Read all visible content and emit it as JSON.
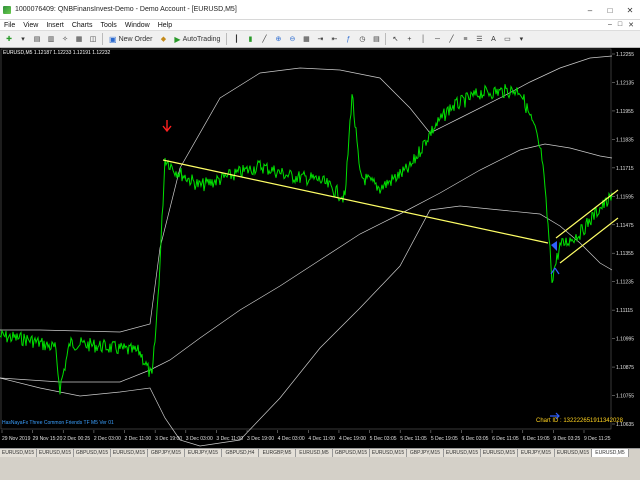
{
  "window": {
    "title": "1000076409: QNBFinansInvest-Demo - Demo Account - [EURUSD,M5]",
    "controls": [
      "–",
      "□",
      "✕"
    ]
  },
  "menu": {
    "items": [
      "File",
      "View",
      "Insert",
      "Charts",
      "Tools",
      "Window",
      "Help"
    ],
    "doc_controls": [
      "–",
      "□",
      "✕"
    ]
  },
  "toolbar": {
    "new_order_label": "New Order",
    "autotrading_label": "AutoTrading"
  },
  "chart": {
    "symbol_info": "EURUSD,M5 1.12187 1.12233 1.12191 1.12232",
    "indicator_name": "HasNayaFx Three Common Friends TF M5 Ver 01",
    "chart_id": "Chart ID : 132222651911342028",
    "colors": {
      "background": "#000000",
      "price": "#00e000",
      "bands": "#ffffff",
      "trendline": "#ffff66",
      "sell_arrow": "#ff2020",
      "buy_marker": "#3060ff"
    },
    "price_labels": [
      "1.12255",
      "1.12135",
      "1.11955",
      "1.11835",
      "1.11715",
      "1.11595",
      "1.11475",
      "1.11355",
      "1.11235",
      "1.11115",
      "1.10995",
      "1.10875",
      "1.10755",
      "1.10635"
    ],
    "time_labels": [
      "29 Nov 2019",
      "29 Nov 15:20",
      "2 Dec 00:25",
      "2 Dec 03:00",
      "2 Dec 11:00",
      "3 Dec 19:00",
      "3 Dec 03:00",
      "3 Dec 11:00",
      "3 Dec 19:00",
      "4 Dec 03:00",
      "4 Dec 11:00",
      "4 Dec 19:00",
      "5 Dec 03:05",
      "5 Dec 11:05",
      "5 Dec 19:05",
      "6 Dec 03:05",
      "6 Dec 11:05",
      "6 Dec 19:05",
      "9 Dec 03:25",
      "9 Dec 11:25"
    ]
  },
  "tabs": [
    "EURUSD,M15",
    "EURUSD,M15",
    "GBPUSD,M15",
    "EURUSD,M15",
    "GBPJPY,M15",
    "EURJPY,M15",
    "GBPUSD,H4",
    "EURGBP,M5",
    "EURUSD,M5",
    "GBPUSD,M15",
    "EURUSD,M15",
    "GBPJPY,M15",
    "EURUSD,M15",
    "EURUSD,M15",
    "EURJPY,M15",
    "EURUSD,M15",
    "EURUSD,M5"
  ]
}
